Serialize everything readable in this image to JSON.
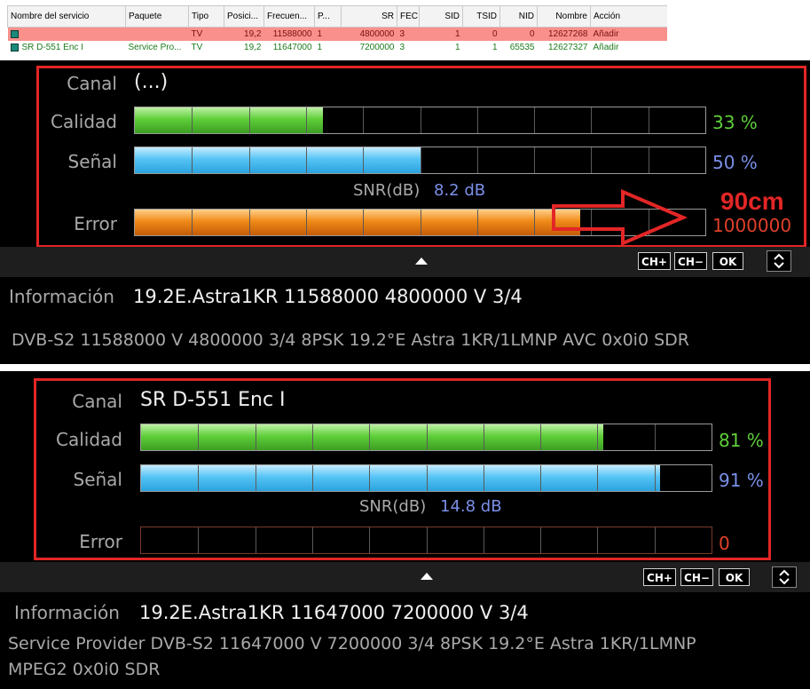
{
  "table": {
    "headers": [
      "Nombre del servicio",
      "Paquete",
      "Tipo",
      "Posici...",
      "Frecuen...",
      "P...",
      "SR",
      "FEC",
      "SID",
      "TSID",
      "NID",
      "Nombre",
      "Acción"
    ],
    "rows": [
      {
        "cells": [
          "",
          "",
          "TV",
          "19,2",
          "11588000",
          "1",
          "4800000",
          "3",
          "1",
          "0",
          "0",
          "12627268",
          "Añadir"
        ],
        "status": "error"
      },
      {
        "cells": [
          "SR D-551 Enc I",
          "Service Pro...",
          "TV",
          "19,2",
          "11647000",
          "1",
          "7200000",
          "3",
          "1",
          "1",
          "65535",
          "12627327",
          "Añadir"
        ],
        "status": "ok"
      }
    ]
  },
  "panel1": {
    "canal_label": "Canal",
    "canal_value": "(...)",
    "calidad_label": "Calidad",
    "calidad_pct": "33 %",
    "calidad_value": 33,
    "senal_label": "Señal",
    "senal_pct": "50 %",
    "senal_value": 50,
    "snr_label": "SNR(dB)",
    "snr_value": "8.2 dB",
    "error_label": "Error",
    "error_value": "1000000",
    "error_fill": 78,
    "annotation": "90cm",
    "info_label": "Información",
    "info_value": "19.2E.Astra1KR 11588000 4800000 V 3/4",
    "info_line": "DVB-S2  11588000  V  4800000  3/4  8PSK  19.2°E  Astra 1KR/1LMNP  AVC  0x0i0  SDR"
  },
  "panel2": {
    "canal_label": "Canal",
    "canal_value": "SR D-551 Enc I",
    "calidad_label": "Calidad",
    "calidad_pct": "81 %",
    "calidad_value": 81,
    "senal_label": "Señal",
    "senal_pct": "91 %",
    "senal_value": 91,
    "snr_label": "SNR(dB)",
    "snr_value": "14.8 dB",
    "error_label": "Error",
    "error_value": "0",
    "error_fill": 0,
    "info_label": "Información",
    "info_value": "19.2E.Astra1KR 11647000 7200000 V 3/4",
    "info_line1": "Service Provider  DVB-S2  11647000  V  7200000  3/4  8PSK  19.2°E  Astra 1KR/1LMNP",
    "info_line2": "MPEG2  0x0i0  SDR"
  },
  "controls": {
    "ch_plus": "CH+",
    "ch_minus": "CH−",
    "ok": "OK"
  },
  "colors": {
    "annotation_red": "#e32626",
    "quality_green": "#5fcf3a",
    "signal_blue": "#56c4f5",
    "error_orange": "#f08a18"
  },
  "icons": {
    "up": "up-arrow-icon",
    "updown": "chevron-up-down-icon",
    "service": "tv-service-icon"
  }
}
